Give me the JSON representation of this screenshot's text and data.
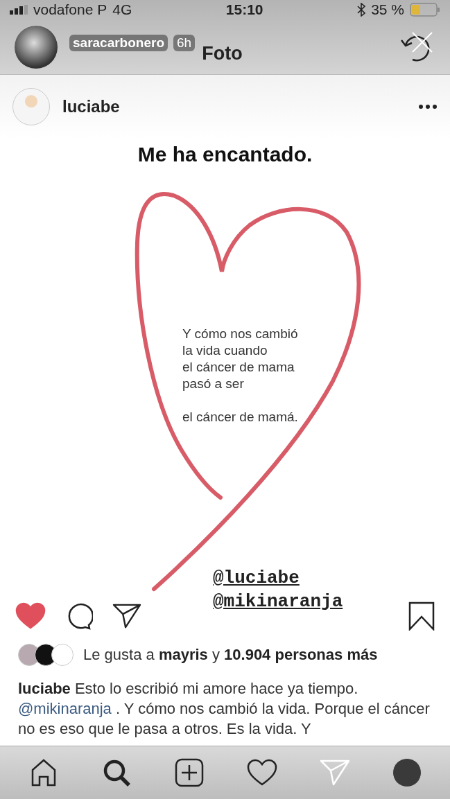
{
  "status_bar": {
    "carrier": "vodafone P",
    "network": "4G",
    "time": "15:10",
    "battery": "35 %"
  },
  "story_header": {
    "user": "saracarbonero",
    "age": "6h",
    "title": "Foto"
  },
  "post": {
    "user": "luciabe",
    "image": {
      "title": "Me ha encantado.",
      "stanzas": [
        [
          "Y cómo nos cambió",
          "la vida cuando",
          "el cáncer de mama",
          "pasó a ser"
        ],
        [
          "el cáncer de mamá."
        ]
      ],
      "mentions": [
        "@luciabe",
        "@mikinaranja"
      ]
    },
    "liked": true,
    "saved": false,
    "likes": "Le gusta a **mayris** y **10.904 personas más**",
    "caption": {
      "user": "luciabe",
      "text_before": "Esto lo escribió mi amore hace ya tiempo.",
      "mention": "@mikinaranja",
      "text_after": ". Y cómo nos cambió la vida. Porque el cáncer no es eso que le pasa a otros. Es la vida. Y"
    }
  },
  "nav": [
    {
      "kind": "home",
      "selected": false
    },
    {
      "kind": "search",
      "selected": true
    },
    {
      "kind": "add",
      "selected": false
    },
    {
      "kind": "activity",
      "selected": false
    },
    {
      "kind": "direct",
      "selected": false
    },
    {
      "kind": "profile",
      "selected": false
    }
  ]
}
